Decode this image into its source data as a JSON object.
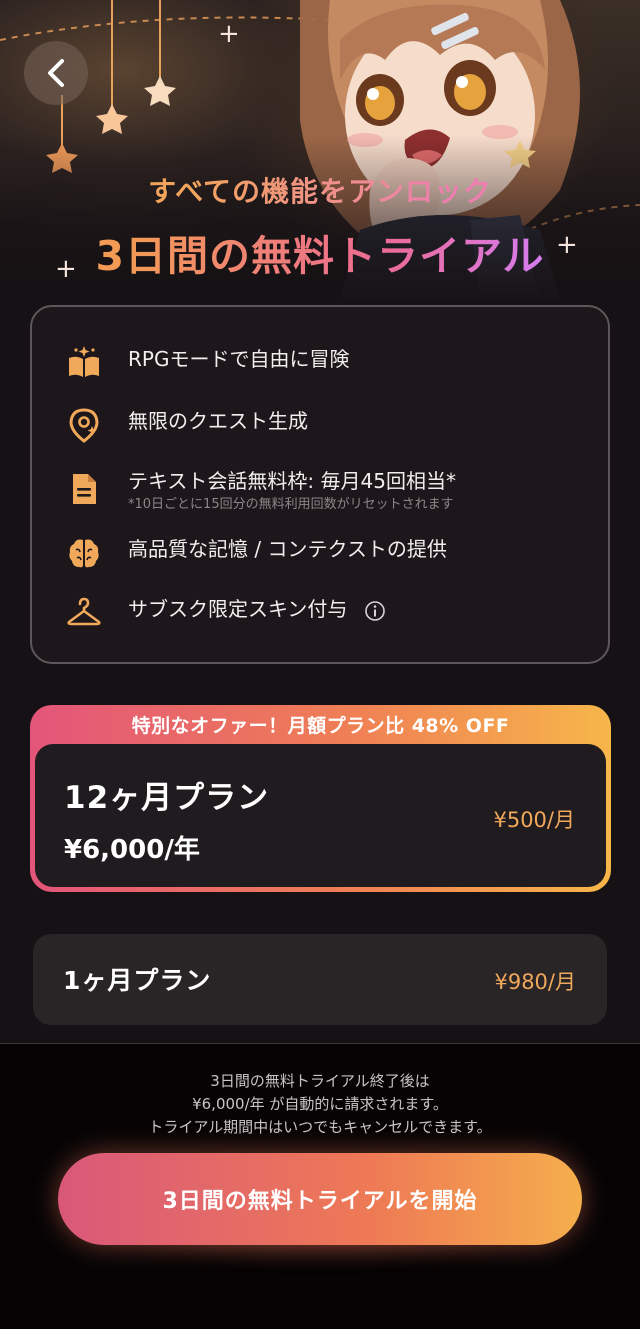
{
  "hero": {
    "subtitle": "すべての機能をアンロック",
    "title": "3日間の無料トライアル",
    "back_icon": "chevron-left-icon",
    "sparkle_glyph": "+"
  },
  "features": [
    {
      "icon": "book-sparkle-icon",
      "label": "RPGモードで自由に冒険"
    },
    {
      "icon": "quest-location-icon",
      "label": "無限のクエスト生成"
    },
    {
      "icon": "document-icon",
      "label": "テキスト会話無料枠: 毎月45回相当*",
      "note": "*10日ごとに15回分の無料利用回数がリセットされます"
    },
    {
      "icon": "brain-icon",
      "label": "高品質な記憶 / コンテクストの提供"
    },
    {
      "icon": "hanger-icon",
      "label": "サブスク限定スキン付与",
      "extra_icon": "info-icon"
    }
  ],
  "plans": {
    "offer_banner": "特別なオファー！月額プラン比 48% OFF",
    "annual": {
      "name": "12ヶ月プラン",
      "total": "¥6,000/年",
      "monthly_price": "¥500/月"
    },
    "monthly": {
      "name": "1ヶ月プラン",
      "price": "¥980/月"
    }
  },
  "footer": {
    "notice_line1": "3日間の無料トライアル終了後は",
    "notice_line2": "¥6,000/年 が自動的に請求されます。",
    "notice_line3": "トライアル期間中はいつでもキャンセルできます。",
    "cta_label": "3日間の無料トライアルを開始"
  },
  "colors": {
    "accent_orange": "#f0a85a",
    "gradient_pink": "#e3557a",
    "gradient_yellow": "#f7b64a",
    "background": "#161114"
  }
}
